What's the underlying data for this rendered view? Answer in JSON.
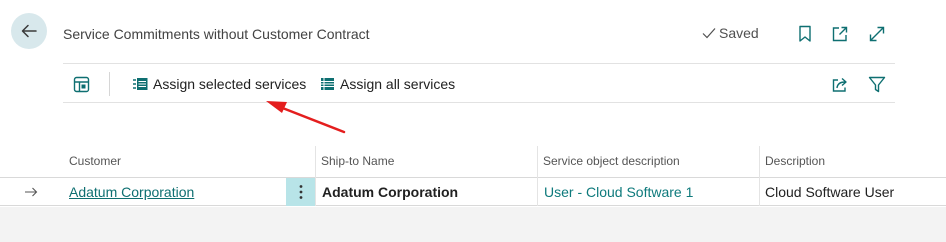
{
  "header": {
    "title": "Service Commitments without Customer Contract",
    "saved_label": "Saved"
  },
  "actions": {
    "assign_selected": "Assign selected services",
    "assign_all": "Assign all services"
  },
  "table": {
    "columns": [
      "Customer",
      "Ship-to Name",
      "Service object description",
      "Description"
    ],
    "rows": [
      {
        "customer": "Adatum Corporation",
        "ship_to_name": "Adatum Corporation",
        "service_object_description": "User - Cloud Software 1",
        "description": "Cloud Software User"
      }
    ]
  },
  "colors": {
    "accent": "#0e6f71",
    "annotation_arrow": "#e41e1e",
    "selected_cell": "#b8e4e8"
  }
}
